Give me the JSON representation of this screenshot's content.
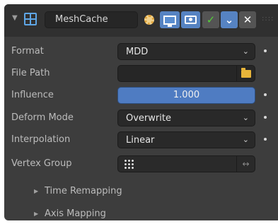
{
  "header": {
    "modifier_name": "MeshCache",
    "collapse_icon": "triangle-down",
    "modifier_icon": "grid-icon",
    "toggles": [
      "editmode-gear",
      "realtime-monitor",
      "render-camera"
    ],
    "apply_buttons": [
      "apply-check",
      "dropdown-chevron",
      "remove-x"
    ]
  },
  "properties": {
    "format": {
      "label": "Format",
      "value": "MDD"
    },
    "file_path": {
      "label": "File Path",
      "value": ""
    },
    "influence": {
      "label": "Influence",
      "value": "1.000"
    },
    "deform_mode": {
      "label": "Deform Mode",
      "value": "Overwrite"
    },
    "interpolation": {
      "label": "Interpolation",
      "value": "Linear"
    },
    "vertex_group": {
      "label": "Vertex Group",
      "value": ""
    }
  },
  "subpanels": [
    {
      "label": "Time Remapping"
    },
    {
      "label": "Axis Mapping"
    }
  ],
  "colors": {
    "panel_bg": "#3d3d3d",
    "header_bg": "#303030",
    "accent_blue": "#4f7cc2",
    "check_green": "#55d03a"
  }
}
